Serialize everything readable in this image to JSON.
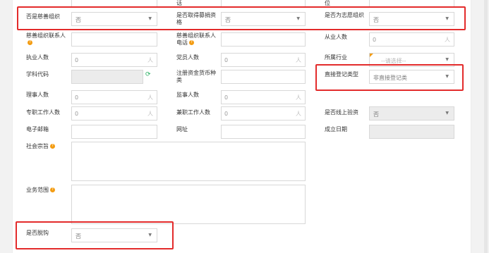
{
  "top_partial": {
    "col2_label_tail": "话",
    "col3_label_tail": "位"
  },
  "fields": {
    "is_charity": {
      "label": "否是慈善组织",
      "value": "否"
    },
    "donation_qual": {
      "label": "是否取得募捐资格",
      "value": "否"
    },
    "volunteer_org": {
      "label": "是否为志愿组织",
      "value": "否"
    },
    "charity_contact": {
      "label": "慈善组织联系人"
    },
    "charity_phone": {
      "label": "慈善组织联系人电话"
    },
    "employees": {
      "label": "从业人数",
      "value": "0",
      "unit": "人"
    },
    "practitioners": {
      "label": "执业人数",
      "value": "0",
      "unit": "人"
    },
    "party_members": {
      "label": "党员人数",
      "value": "0",
      "unit": "人"
    },
    "industry": {
      "label": "所属行业",
      "value": "--请选择--"
    },
    "discipline_code": {
      "label": "学科代码"
    },
    "capital_currency": {
      "label": "注册资金货币种类"
    },
    "reg_type": {
      "label": "直接登记类型",
      "value": "非直接登记类"
    },
    "directors": {
      "label": "理事人数",
      "value": "0",
      "unit": "人"
    },
    "supervisors": {
      "label": "监事人数",
      "value": "0",
      "unit": "人"
    },
    "fulltime_staff": {
      "label": "专职工作人数",
      "value": "0",
      "unit": "人"
    },
    "parttime_staff": {
      "label": "兼职工作人数",
      "value": "0",
      "unit": "人"
    },
    "online_verify": {
      "label": "是否线上验资",
      "value": "否"
    },
    "email": {
      "label": "电子邮箱"
    },
    "website": {
      "label": "网址"
    },
    "founded": {
      "label": "成立日期"
    },
    "purpose": {
      "label": "社会宗旨"
    },
    "scope": {
      "label": "业务范围"
    },
    "decoupled": {
      "label": "是否脱钩",
      "value": "否"
    }
  },
  "icons": {
    "help": "?",
    "caret": "▼",
    "refresh": "⟳"
  },
  "colors": {
    "highlight": "#e32b2b",
    "help_icon": "#f39c12",
    "refresh_icon": "#27ae60"
  }
}
